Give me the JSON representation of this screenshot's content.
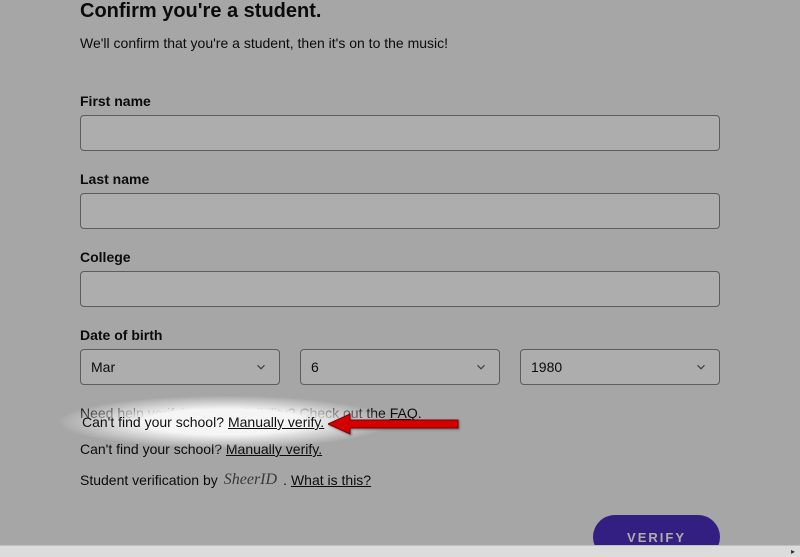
{
  "heading": "Confirm you're a student.",
  "subtitle": "We'll confirm that you're a student, then it's on to the music!",
  "fields": {
    "first_name": {
      "label": "First name",
      "value": ""
    },
    "last_name": {
      "label": "Last name",
      "value": ""
    },
    "college": {
      "label": "College",
      "value": ""
    }
  },
  "dob": {
    "label": "Date of birth",
    "month": "Mar",
    "day": "6",
    "year": "1980"
  },
  "help": {
    "eligibility_prefix": "Need help verifying your eligibility? Check out the ",
    "faq_label": "FAQ",
    "eligibility_suffix": ".",
    "cantfind_prefix": "Can't find your school? ",
    "manual_label": "Manually verify."
  },
  "verification": {
    "prefix": "Student verification by",
    "brand": "SheerID",
    "suffix": ".",
    "whatis": "What is this?"
  },
  "buttons": {
    "verify": "VERIFY"
  },
  "colors": {
    "primary": "#4b2fbf"
  }
}
